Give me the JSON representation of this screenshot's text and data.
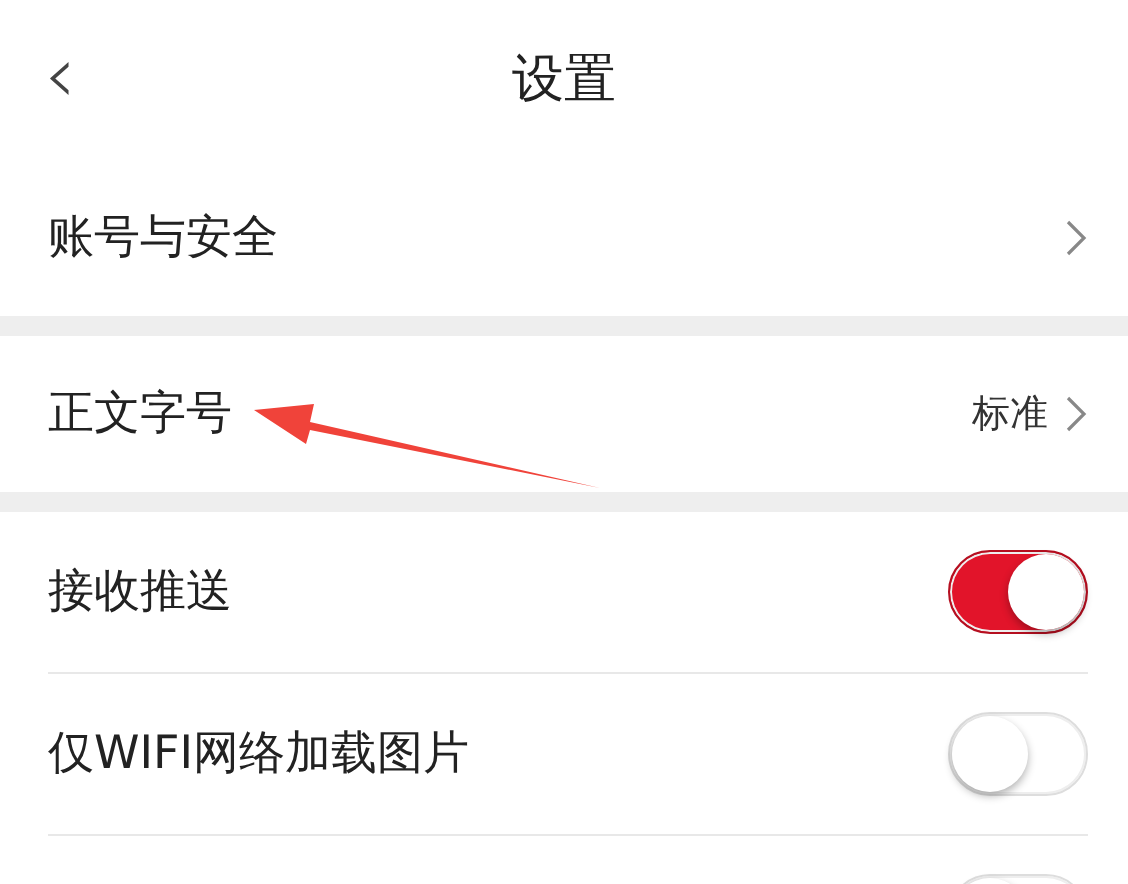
{
  "header": {
    "back_icon": "‹",
    "title": "设置"
  },
  "sections": [
    {
      "items": [
        {
          "kind": "link",
          "label": "账号与安全"
        }
      ]
    },
    {
      "annotation": {
        "kind": "arrow"
      },
      "items": [
        {
          "kind": "link",
          "label": "正文字号",
          "value": "标准"
        }
      ]
    },
    {
      "items": [
        {
          "kind": "switch",
          "label": "接收推送",
          "on": true
        },
        {
          "kind": "switch",
          "label": "仅WIFI网络加载图片",
          "on": false
        },
        {
          "kind": "switch",
          "on": false
        }
      ]
    }
  ]
}
